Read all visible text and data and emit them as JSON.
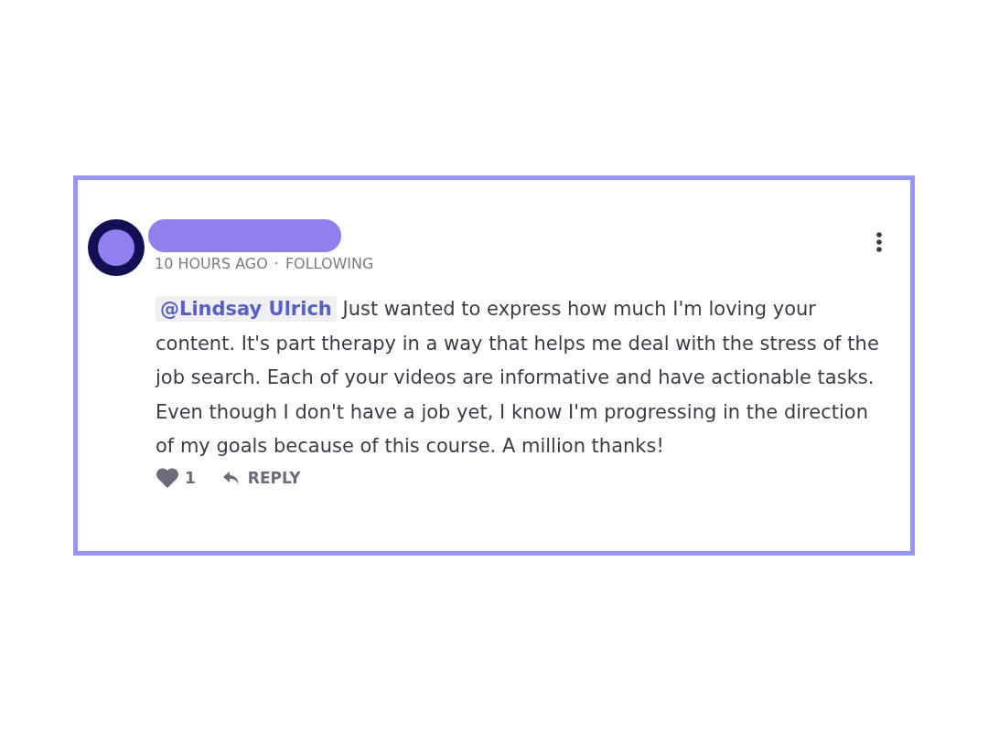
{
  "comment": {
    "time": "10 HOURS AGO",
    "separator": "·",
    "status": "FOLLOWING",
    "mention": "@Lindsay Ulrich",
    "text": "Just wanted to express how much I'm loving your content. It's part therapy in a way that helps me deal with the stress of the job search. Each of your videos are informative and have actionable tasks. Even though I don't have a job yet, I know I'm progressing in the direction of my goals because of this course. A million thanks!",
    "likes": "1",
    "reply": "REPLY"
  }
}
